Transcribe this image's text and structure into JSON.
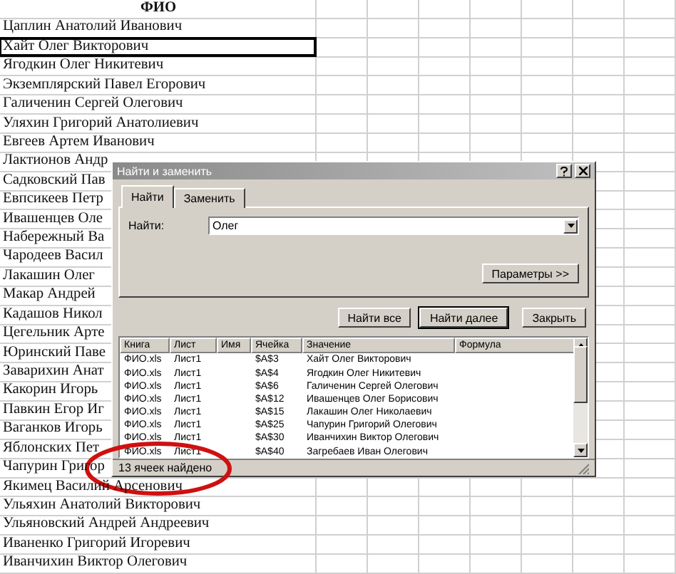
{
  "sheet": {
    "header": "ФИО",
    "rows": [
      {
        "name": "Цаплин Анатолий Иванович",
        "selected": false
      },
      {
        "name": "Хайт Олег Викторович",
        "selected": true
      },
      {
        "name": "Ягодкин Олег Никитевич",
        "selected": false
      },
      {
        "name": "Экземплярский Павел Егорович",
        "selected": false
      },
      {
        "name": "Галиченин Сергей Олегович",
        "selected": false
      },
      {
        "name": "Уляхин Григорий Анатолиевич",
        "selected": false
      },
      {
        "name": "Евгеев Артем Иванович",
        "selected": false
      },
      {
        "name": "Лактионов Андр",
        "selected": false
      },
      {
        "name": "Садковский Пав",
        "selected": false
      },
      {
        "name": "Евпсикеев Петр",
        "selected": false
      },
      {
        "name": "Ивашенцев Оле",
        "selected": false
      },
      {
        "name": "Набережный Ва",
        "selected": false
      },
      {
        "name": "Чародеев Васил",
        "selected": false
      },
      {
        "name": "Лакашин Олег",
        "selected": false
      },
      {
        "name": "Макар Андрей",
        "selected": false
      },
      {
        "name": "Кадашов Никол",
        "selected": false
      },
      {
        "name": "Цегельник Арте",
        "selected": false
      },
      {
        "name": "Юринский Паве",
        "selected": false
      },
      {
        "name": "Заварихин Анат",
        "selected": false
      },
      {
        "name": "Какорин Игорь",
        "selected": false
      },
      {
        "name": "Павкин Егор Иг",
        "selected": false
      },
      {
        "name": "Ваганков Игорь",
        "selected": false
      },
      {
        "name": "Яблонских Пет",
        "selected": false
      },
      {
        "name": "Чапурин Григор",
        "selected": false
      },
      {
        "name": "Якимец Василий Арсенович",
        "selected": false
      },
      {
        "name": "Ульяхин Анатолий Викторович",
        "selected": false
      },
      {
        "name": "Ульяновский Андрей Андреевич",
        "selected": false
      },
      {
        "name": "Иваненко Григорий Игоревич",
        "selected": false
      },
      {
        "name": "Иванчихин Виктор Олегович",
        "selected": false
      }
    ]
  },
  "dialog": {
    "title": "Найти и заменить",
    "tabs": [
      {
        "label": "Найти",
        "selected": true
      },
      {
        "label": "Заменить",
        "selected": false
      }
    ],
    "find_label": "Найти:",
    "find_value": "Олег",
    "options_button": "Параметры >>",
    "buttons": [
      {
        "label": "Найти все",
        "default": false
      },
      {
        "label": "Найти далее",
        "default": true
      },
      {
        "label": "Закрыть",
        "default": false
      }
    ],
    "results": {
      "columns": [
        "Книга",
        "Лист",
        "Имя",
        "Ячейка",
        "Значение",
        "Формула"
      ],
      "rows": [
        [
          "ФИО.xls",
          "Лист1",
          "",
          "$A$3",
          "Хайт Олег Викторович",
          ""
        ],
        [
          "ФИО.xls",
          "Лист1",
          "",
          "$A$4",
          "Ягодкин Олег Никитевич",
          ""
        ],
        [
          "ФИО.xls",
          "Лист1",
          "",
          "$A$6",
          "Галиченин Сергей Олегович",
          ""
        ],
        [
          "ФИО.xls",
          "Лист1",
          "",
          "$A$12",
          "Ивашенцев Олег Борисович",
          ""
        ],
        [
          "ФИО.xls",
          "Лист1",
          "",
          "$A$15",
          "Лакашин Олег Николаевич",
          ""
        ],
        [
          "ФИО.xls",
          "Лист1",
          "",
          "$A$25",
          "Чапурин Григорий Олегович",
          ""
        ],
        [
          "ФИО.xls",
          "Лист1",
          "",
          "$A$30",
          "Иванчихин Виктор Олегович",
          ""
        ],
        [
          "ФИО.xls",
          "Лист1",
          "",
          "$A$40",
          "Загребаев Иван Олегович",
          ""
        ]
      ]
    },
    "status": "13 ячеек найдено"
  }
}
